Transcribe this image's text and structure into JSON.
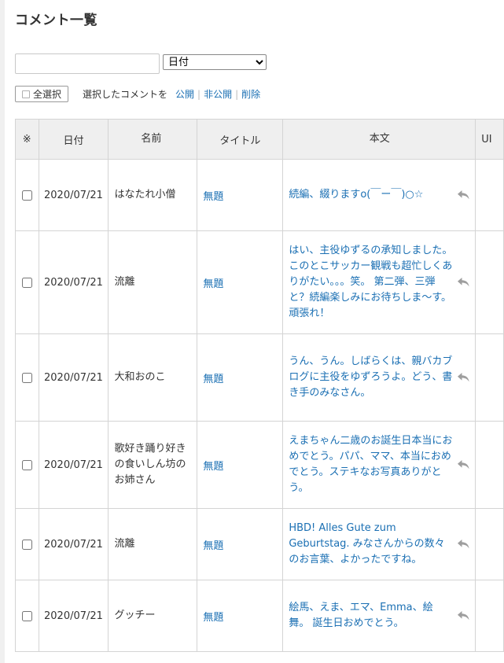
{
  "page": {
    "title": "コメント一覧"
  },
  "filter": {
    "search_value": "",
    "sort_selected": "日付"
  },
  "bulk": {
    "select_all_label": "全選択",
    "prompt": "選択したコメントを",
    "publish": "公開",
    "unpublish": "非公開",
    "delete": "削除"
  },
  "table": {
    "headers": {
      "check": "※",
      "date": "日付",
      "name": "名前",
      "title": "タイトル",
      "body": "本文",
      "url": "UI"
    },
    "rows": [
      {
        "date": "2020/07/21",
        "name": "はなたれ小僧",
        "title": "無題",
        "body": "続編、綴りますo(￣ー￣)○☆"
      },
      {
        "date": "2020/07/21",
        "name": "流離",
        "title": "無題",
        "body": "はい、主役ゆずるの承知しました。 このとこサッカー観戦も超忙しくありがたい。。。笑。 第二弾、三弾と？続編楽しみにお待ちしま～す。 頑張れ！"
      },
      {
        "date": "2020/07/21",
        "name": "大和おのこ",
        "title": "無題",
        "body": "うん、うん。しばらくは、親バカブログに主役をゆずろうよ。どう、書き手のみなさん。"
      },
      {
        "date": "2020/07/21",
        "name": "歌好き踊り好きの食いしん坊のお姉さん",
        "title": "無題",
        "body": "えまちゃん二歳のお誕生日本当におめでとう。パパ、ママ、本当におめでとう。ステキなお写真ありがとう。"
      },
      {
        "date": "2020/07/21",
        "name": "流離",
        "title": "無題",
        "body": "HBD! Alles Gute zum Geburtstag. みなさんからの数々のお言葉、よかったですね。"
      },
      {
        "date": "2020/07/21",
        "name": "グッチー",
        "title": "無題",
        "body": "絵馬、えま、エマ、Emma、絵舞。 誕生日おめでとう。"
      }
    ]
  },
  "icons": {
    "reply": "reply-arrow-icon"
  },
  "colors": {
    "link": "#1a6fb3",
    "header_bg": "#efefef",
    "border": "#d4d4d4"
  }
}
